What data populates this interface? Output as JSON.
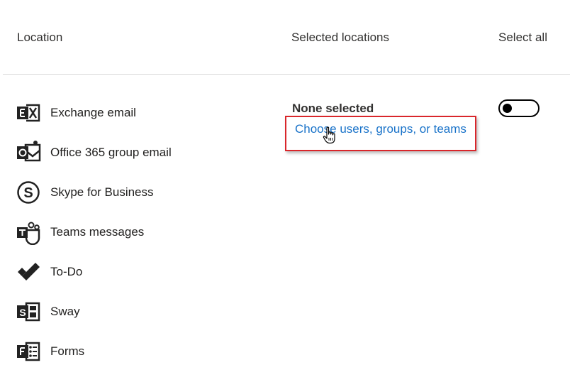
{
  "header": {
    "location": "Location",
    "selected_locations": "Selected locations",
    "select_all": "Select all"
  },
  "locations": [
    {
      "label": "Exchange email",
      "icon": "exchange-icon"
    },
    {
      "label": "Office 365 group email",
      "icon": "group-email-icon"
    },
    {
      "label": "Skype for Business",
      "icon": "skype-icon"
    },
    {
      "label": "Teams messages",
      "icon": "teams-icon"
    },
    {
      "label": "To-Do",
      "icon": "todo-icon"
    },
    {
      "label": "Sway",
      "icon": "sway-icon"
    },
    {
      "label": "Forms",
      "icon": "forms-icon"
    }
  ],
  "selection": {
    "status": "None selected",
    "link": "Choose users, groups, or teams"
  },
  "select_all_toggle": {
    "on": false
  },
  "colors": {
    "link": "#1a73c9",
    "highlight": "#d9262b"
  }
}
